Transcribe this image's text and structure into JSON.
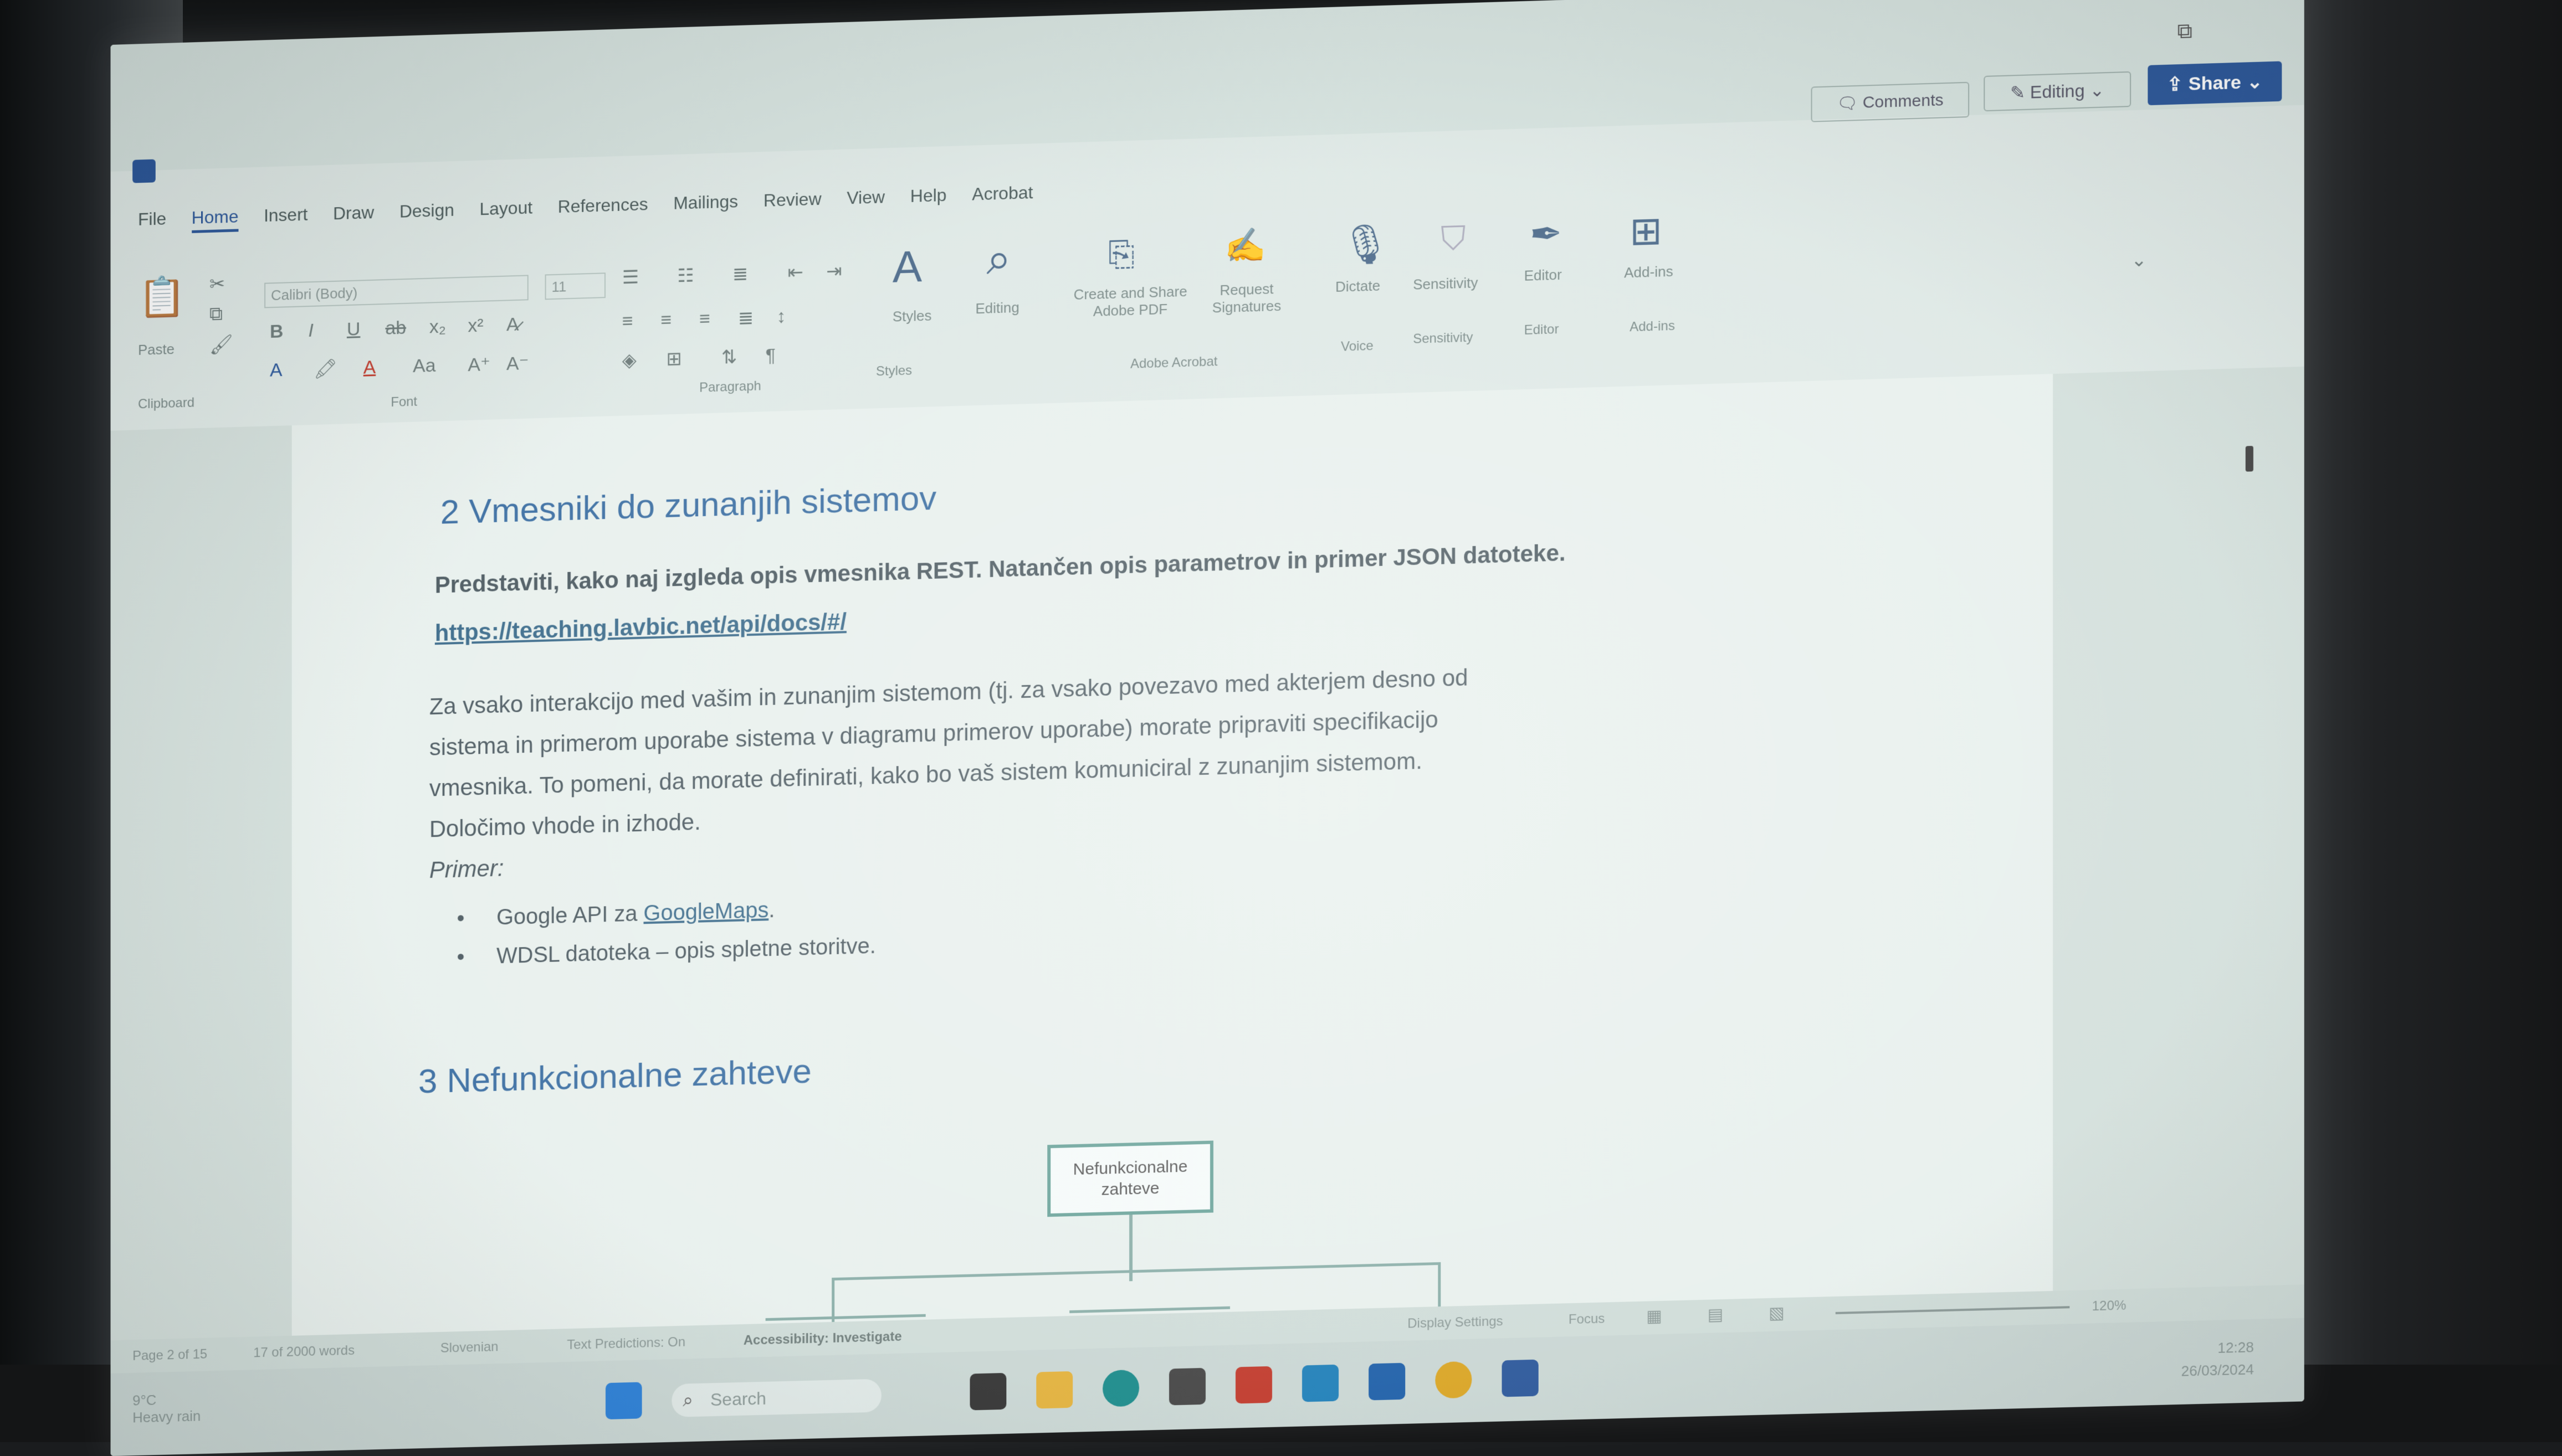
{
  "window": {
    "share_label": "Share",
    "editing_label": "Editing",
    "comments_label": "Comments"
  },
  "menu": {
    "tabs": [
      "File",
      "Home",
      "Insert",
      "Draw",
      "Design",
      "Layout",
      "References",
      "Mailings",
      "Review",
      "View",
      "Help",
      "Acrobat"
    ]
  },
  "ribbon": {
    "font_name": "Calibri (Body)",
    "font_size": "11",
    "paste_label": "Paste",
    "clipboard_label": "Clipboard",
    "font_label": "Font",
    "paragraph_label": "Paragraph",
    "styles_label": "Styles",
    "styles_group_label": "Styles",
    "editing_label": "Editing",
    "create_share_label": "Create and Share Adobe PDF",
    "request_sig_label": "Request Signatures",
    "adobe_group_label": "Adobe Acrobat",
    "dictate_label": "Dictate",
    "voice_label": "Voice",
    "sensitivity_label": "Sensitivity",
    "editor_label": "Editor",
    "editor_group_label": "Editor",
    "addins_label": "Add-ins",
    "addins_group_label": "Add-ins"
  },
  "document": {
    "heading1": "2 Vmesniki do zunanjih sistemov",
    "intro": "Predstaviti, kako naj izgleda opis vmesnika REST. Natančen opis parametrov in primer JSON datoteke.",
    "link": "https://teaching.lavbic.net/api/docs/#/",
    "para_line1": "Za vsako interakcijo med vašim in zunanjim sistemom (tj. za vsako povezavo med akterjem desno od",
    "para_line2": "sistema in primerom uporabe sistema v diagramu primerov uporabe) morate pripraviti specifikacijo",
    "para_line3": "vmesnika. To pomeni, da morate definirati, kako bo vaš sistem komuniciral z zunanjim sistemom.",
    "para_line4": "Določimo vhode in izhode.",
    "primer_label": "Primer:",
    "bullet1_prefix": "Google API za ",
    "bullet1_link": "GoogleMaps",
    "bullet1_suffix": ".",
    "bullet2": "WDSL datoteka – opis spletne storitve.",
    "heading2": "3 Nefunkcionalne zahteve",
    "diagram_box": "Nefunkcionalne zahteve"
  },
  "statusbar": {
    "page": "Page 2 of 15",
    "words": "17 of 2000 words",
    "language": "Slovenian",
    "predictions": "Text Predictions: On",
    "accessibility": "Accessibility: Investigate",
    "display_settings": "Display Settings",
    "focus": "Focus",
    "zoom": "120%"
  },
  "taskbar": {
    "weather_temp": "9°C",
    "weather_desc": "Heavy rain",
    "search_placeholder": "Search",
    "time": "12:28",
    "date": "26/03/2024"
  },
  "colors": {
    "accent": "#2b579a",
    "heading": "#3b6ea2",
    "diagram_border": "#6aa39a"
  }
}
